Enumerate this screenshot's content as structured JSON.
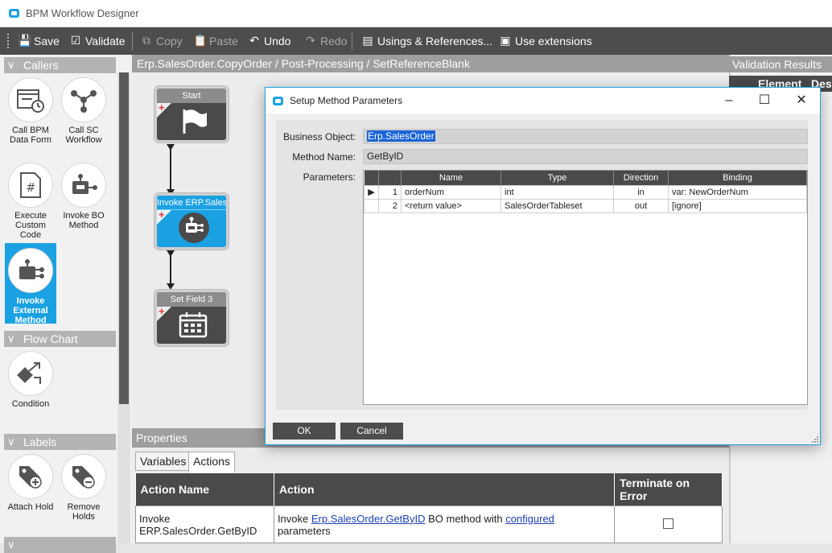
{
  "window": {
    "title": "BPM Workflow Designer"
  },
  "toolbar": {
    "save": "Save",
    "validate": "Validate",
    "copy": "Copy",
    "paste": "Paste",
    "undo": "Undo",
    "redo": "Redo",
    "usings": "Usings & References...",
    "extensions": "Use extensions"
  },
  "toolbox": {
    "callers": "Callers",
    "call_bpm": "Call BPM Data Form",
    "call_sc": "Call SC Workflow",
    "execute_code": "Execute Custom Code",
    "invoke_bo": "Invoke BO Method",
    "invoke_external": "Invoke External Method",
    "flow_chart": "Flow Chart",
    "condition": "Condition",
    "labels": "Labels",
    "attach_hold": "Attach Hold",
    "remove_holds": "Remove Holds"
  },
  "breadcrumb": "Erp.SalesOrder.CopyOrder / Post-Processing / SetReferenceBlank",
  "nodes": {
    "start": "Start",
    "invoke": "Invoke ERP.SalesOrder",
    "setfield": "Set Field 3"
  },
  "properties": {
    "title": "Properties",
    "tab_variables": "Variables",
    "tab_actions": "Actions",
    "col_action_name": "Action Name",
    "col_action": "Action",
    "col_terminate": "Terminate on Error",
    "row_name": "Invoke ERP.SalesOrder.GetByID",
    "row_action_prefix": "Invoke ",
    "row_action_link": "Erp.SalesOrder.GetByID",
    "row_action_mid": " BO method with ",
    "row_action_link2": "configured",
    "row_action_suffix": "parameters"
  },
  "validation": {
    "title": "Validation Results",
    "col_element": "Element",
    "col_desc": "Description"
  },
  "dialog": {
    "title": "Setup Method Parameters",
    "bo_label": "Business Object:",
    "bo_value": "Erp.SalesOrder",
    "method_label": "Method Name:",
    "method_value": "GetByID",
    "params_label": "Parameters:",
    "columns": [
      "Name",
      "Type",
      "Direction",
      "Binding"
    ],
    "rows": [
      {
        "num": "1",
        "name": "orderNum",
        "type": "int",
        "direction": "in",
        "binding": "var: NewOrderNum"
      },
      {
        "num": "2",
        "name": "<return value>",
        "type": "SalesOrderTableset",
        "direction": "out",
        "binding": "[ignore]"
      }
    ],
    "ok": "OK",
    "cancel": "Cancel"
  }
}
